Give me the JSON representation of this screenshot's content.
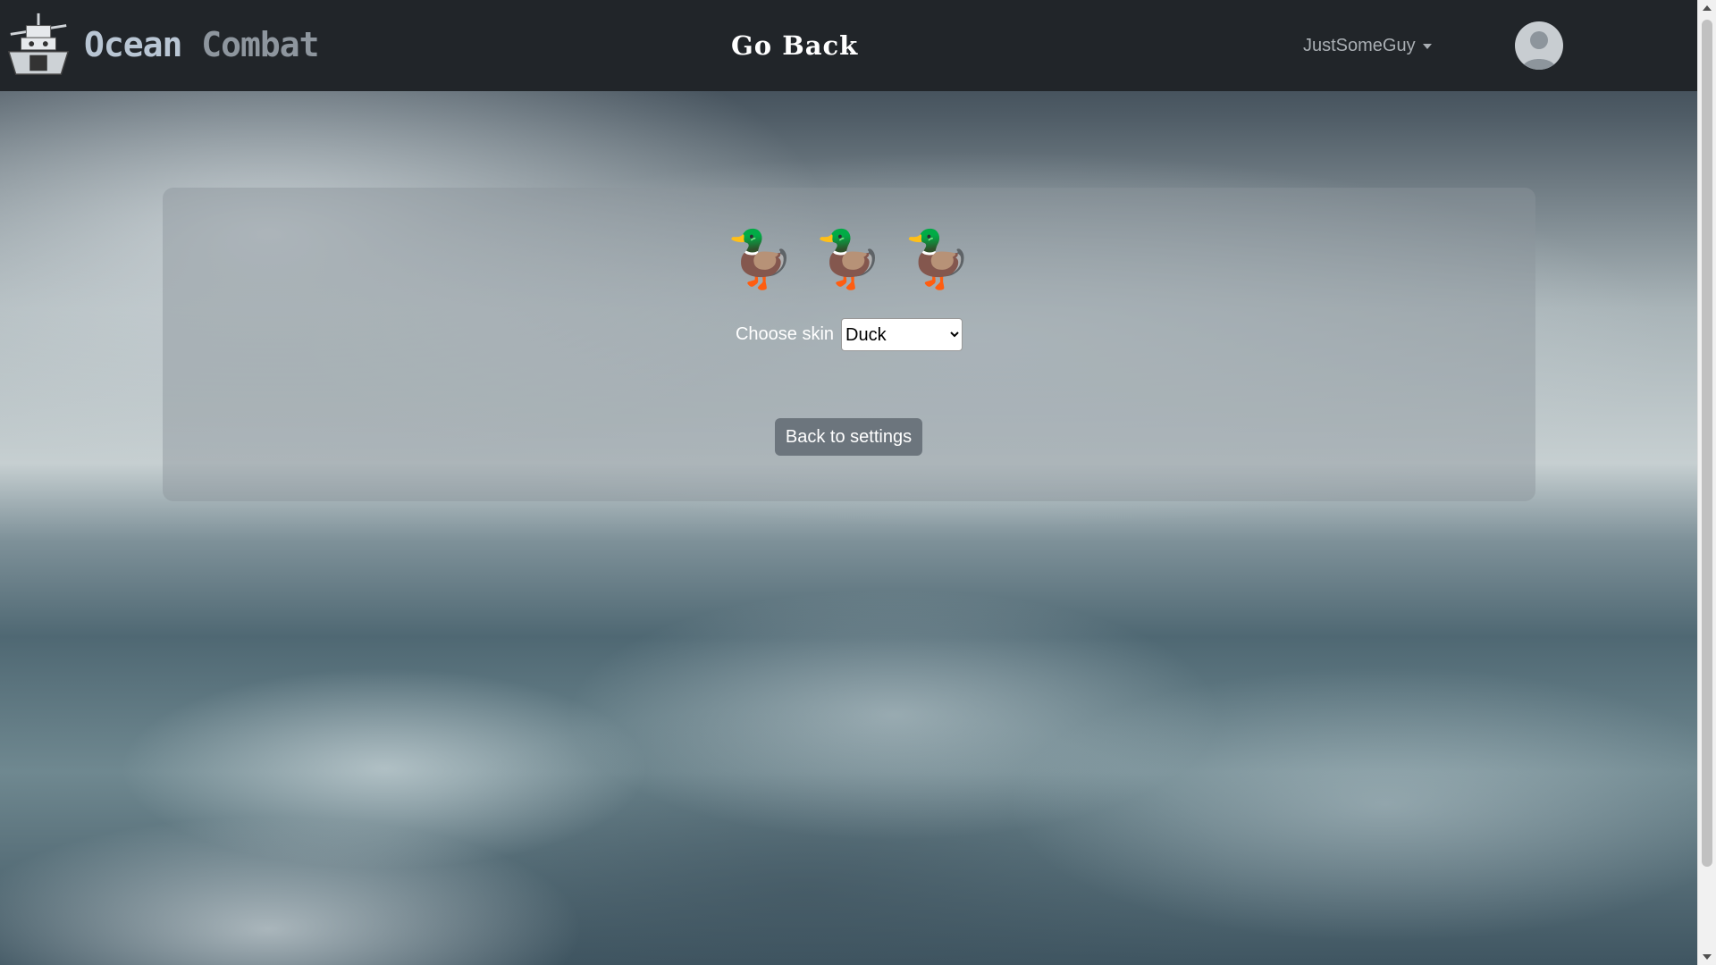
{
  "navbar": {
    "brand_word1": "Ocean",
    "brand_word2": "Combat",
    "center_link": "Go Back",
    "username": "JustSomeGuy",
    "avatar_icon": "user-avatar-icon",
    "logo_icon": "battleship-logo-icon"
  },
  "skin_panel": {
    "preview": [
      "🦆",
      "🦆",
      "🦆"
    ],
    "choose_label": "Choose skin",
    "selected_skin": "Duck",
    "back_button": "Back to settings"
  },
  "colors": {
    "navbar": "#212529",
    "button": "#6c757d",
    "brand_primary": "#b9c6d4"
  }
}
